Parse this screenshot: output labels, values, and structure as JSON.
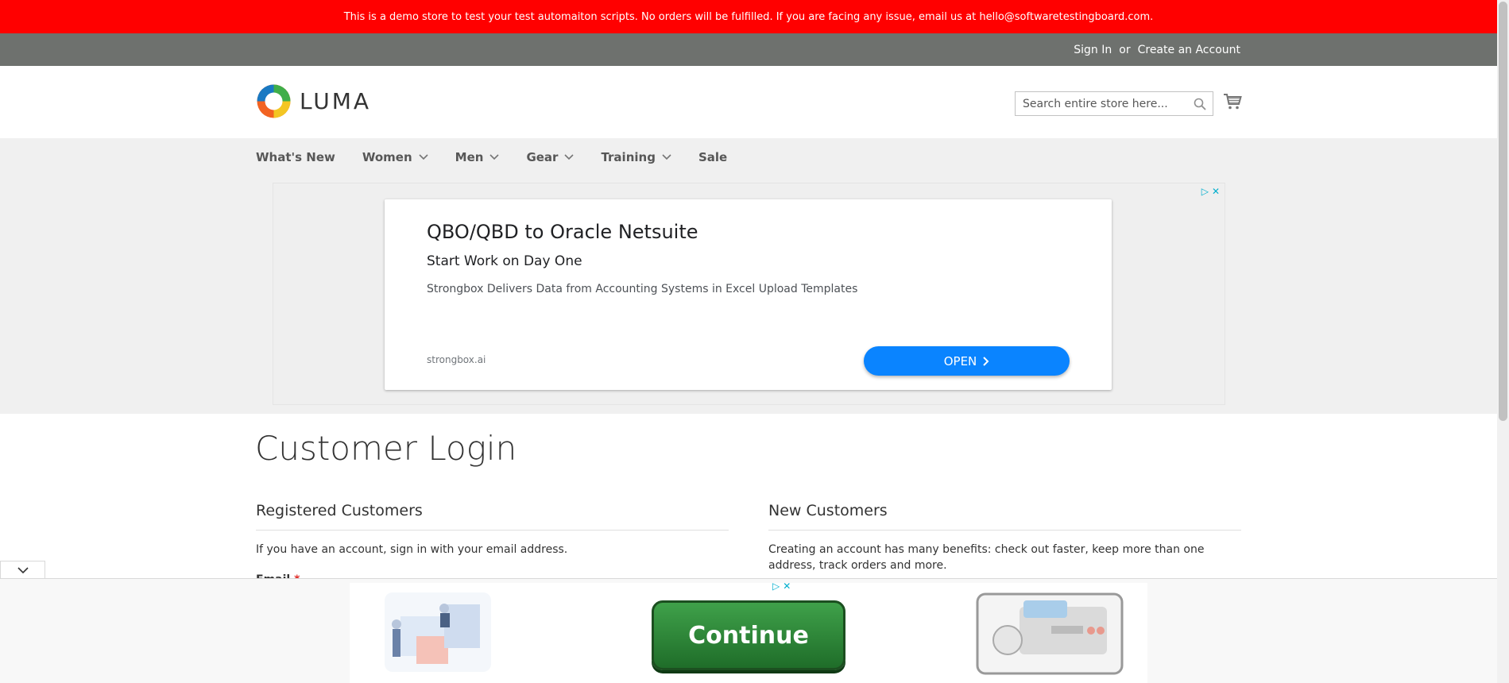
{
  "demo_banner": {
    "text": "This is a demo store to test your test automaiton scripts. No orders will be fulfilled. If you are facing any issue, email us at hello@softwaretestingboard.com."
  },
  "panel": {
    "sign_in": "Sign In",
    "or": "or",
    "create_account": "Create an Account"
  },
  "header": {
    "logo_text": "LUMA",
    "search_placeholder": "Search entire store here...",
    "search_icon": "search-icon",
    "cart_icon": "cart-icon"
  },
  "nav": {
    "items": [
      {
        "label": "What's New",
        "has_dropdown": false
      },
      {
        "label": "Women",
        "has_dropdown": true
      },
      {
        "label": "Men",
        "has_dropdown": true
      },
      {
        "label": "Gear",
        "has_dropdown": true
      },
      {
        "label": "Training",
        "has_dropdown": true
      },
      {
        "label": "Sale",
        "has_dropdown": false
      }
    ]
  },
  "ad_top": {
    "title": "QBO/QBD to Oracle Netsuite",
    "subtitle": "Start Work on Day One",
    "description": "Strongbox Delivers Data from Accounting Systems in Excel Upload Templates",
    "domain": "strongbox.ai",
    "button_label": "OPEN",
    "accent": "#0a84ff"
  },
  "main": {
    "page_title": "Customer Login",
    "registered": {
      "title": "Registered Customers",
      "text": "If you have an account, sign in with your email address.",
      "email_label": "Email",
      "required_mark": "*"
    },
    "new_customers": {
      "title": "New Customers",
      "text": "Creating an account has many benefits: check out faster, keep more than one address, track orders and more."
    }
  },
  "ad_bottom": {
    "button_label": "Continue"
  },
  "colors": {
    "banner": "#ff0000",
    "panel": "#6e716e",
    "nav_bg": "#f0f0f0"
  }
}
